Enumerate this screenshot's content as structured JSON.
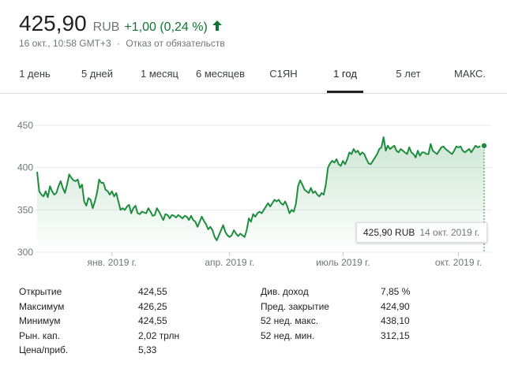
{
  "quote": {
    "price": "425,90",
    "currency": "RUB",
    "change": "+1,00 (0,24 %)",
    "timestamp": "16 окт., 10:58 GMT+3",
    "separator": "·",
    "disclaimer": "Отказ от обязательств"
  },
  "tabs": [
    {
      "label": "1 день",
      "active": false
    },
    {
      "label": "5 дней",
      "active": false
    },
    {
      "label": "1 месяц",
      "active": false
    },
    {
      "label": "6 месяцев",
      "active": false
    },
    {
      "label": "С1ЯН",
      "active": false
    },
    {
      "label": "1 год",
      "active": true
    },
    {
      "label": "5 лет",
      "active": false
    },
    {
      "label": "МАКС.",
      "active": false
    }
  ],
  "tooltip": {
    "price": "425,90 RUB",
    "date": "14 окт. 2019 г."
  },
  "stats": {
    "left": [
      {
        "label": "Открытие",
        "value": "424,55"
      },
      {
        "label": "Максимум",
        "value": "426,25"
      },
      {
        "label": "Минимум",
        "value": "424,55"
      },
      {
        "label": "Рын. кап.",
        "value": "2,02 трлн"
      },
      {
        "label": "Цена/приб.",
        "value": "5,33"
      }
    ],
    "right": [
      {
        "label": "Див. доход",
        "value": "7,85 %"
      },
      {
        "label": "Пред. закрытие",
        "value": "424,90"
      },
      {
        "label": "52 нед. макс.",
        "value": "438,10"
      },
      {
        "label": "52 нед. мин.",
        "value": "312,15"
      }
    ]
  },
  "colors": {
    "up": "#137333",
    "line": "#1e8e3e",
    "grid": "#e8eaed",
    "muted": "#70757a"
  },
  "chart_data": {
    "type": "area",
    "ylim": [
      300,
      450
    ],
    "yticks": [
      300,
      350,
      400,
      450
    ],
    "ytick_labels": [
      "300",
      "350",
      "400",
      "450"
    ],
    "xticks": [
      {
        "label": "янв. 2019 г.",
        "index": 35
      },
      {
        "label": "апр. 2019 г.",
        "index": 90
      },
      {
        "label": "июль 2019 г.",
        "index": 143
      },
      {
        "label": "окт. 2019 г.",
        "index": 197
      }
    ],
    "x_count": 210,
    "values": [
      395,
      372,
      368,
      366,
      372,
      365,
      378,
      372,
      368,
      370,
      378,
      384,
      376,
      370,
      380,
      392,
      388,
      385,
      384,
      386,
      376,
      380,
      360,
      355,
      364,
      362,
      352,
      360,
      370,
      386,
      382,
      382,
      374,
      372,
      368,
      372,
      366,
      370,
      360,
      350,
      352,
      350,
      354,
      356,
      346,
      352,
      355,
      346,
      345,
      348,
      347,
      346,
      352,
      348,
      343,
      344,
      352,
      348,
      343,
      338,
      345,
      344,
      340,
      344,
      343,
      341,
      344,
      342,
      340,
      343,
      342,
      338,
      343,
      338,
      336,
      330,
      336,
      342,
      337,
      333,
      327,
      330,
      326,
      318,
      314,
      320,
      326,
      332,
      324,
      320,
      318,
      320,
      326,
      322,
      319,
      322,
      320,
      318,
      326,
      340,
      336,
      345,
      342,
      346,
      348,
      346,
      350,
      354,
      358,
      354,
      358,
      362,
      360,
      362,
      358,
      356,
      360,
      354,
      346,
      350,
      348,
      357,
      378,
      385,
      380,
      374,
      372,
      370,
      376,
      370,
      372,
      368,
      366,
      370,
      368,
      380,
      400,
      405,
      408,
      406,
      410,
      404,
      402,
      408,
      404,
      410,
      418,
      416,
      422,
      418,
      420,
      415,
      418,
      416,
      410,
      405,
      404,
      408,
      412,
      416,
      422,
      424,
      436,
      420,
      426,
      422,
      424,
      426,
      420,
      418,
      422,
      420,
      418,
      416,
      424,
      418,
      416,
      412,
      420,
      414,
      418,
      418,
      416,
      416,
      428,
      420,
      418,
      416,
      420,
      424,
      425,
      422,
      420,
      418,
      416,
      420,
      425,
      424,
      425,
      420,
      418,
      420,
      422,
      418,
      422,
      426,
      424,
      425,
      426,
      425.9
    ],
    "last_value": 425.9
  }
}
